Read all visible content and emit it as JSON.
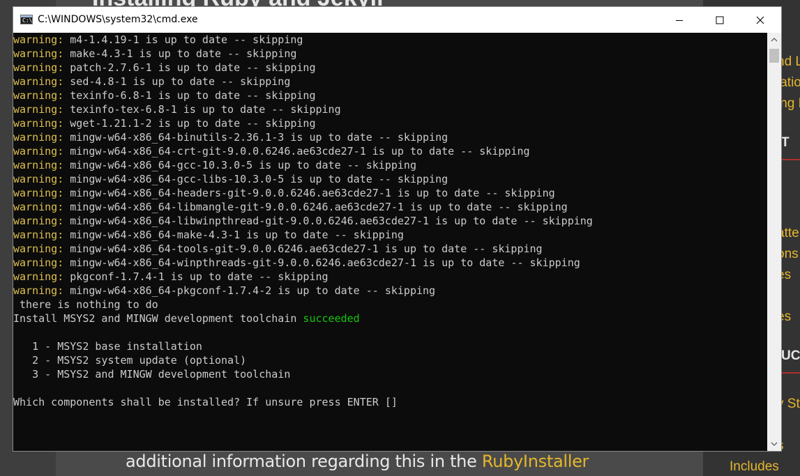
{
  "background_page": {
    "title": "Installing Ruby and Jekyll",
    "bottom_text": "additional information regarding this in the ",
    "bottom_link": "RubyInstaller",
    "sidebar": {
      "fragments": [
        "nd L",
        "latio",
        "ing F",
        "T",
        "atte",
        "ons",
        "es",
        "es",
        "UCT",
        "y St",
        "s",
        "Includes"
      ]
    }
  },
  "window": {
    "title": "C:\\WINDOWS\\system32\\cmd.exe",
    "icon": "cmd-icon",
    "controls": {
      "minimize": "minimize-icon",
      "maximize": "maximize-icon",
      "close": "close-icon"
    }
  },
  "terminal": {
    "warnings": [
      {
        "label": "warning:",
        "text": " m4-1.4.19-1 is up to date -- skipping"
      },
      {
        "label": "warning:",
        "text": " make-4.3-1 is up to date -- skipping"
      },
      {
        "label": "warning:",
        "text": " patch-2.7.6-1 is up to date -- skipping"
      },
      {
        "label": "warning:",
        "text": " sed-4.8-1 is up to date -- skipping"
      },
      {
        "label": "warning:",
        "text": " texinfo-6.8-1 is up to date -- skipping"
      },
      {
        "label": "warning:",
        "text": " texinfo-tex-6.8-1 is up to date -- skipping"
      },
      {
        "label": "warning:",
        "text": " wget-1.21.1-2 is up to date -- skipping"
      },
      {
        "label": "warning:",
        "text": " mingw-w64-x86_64-binutils-2.36.1-3 is up to date -- skipping"
      },
      {
        "label": "warning:",
        "text": " mingw-w64-x86_64-crt-git-9.0.0.6246.ae63cde27-1 is up to date -- skipping"
      },
      {
        "label": "warning:",
        "text": " mingw-w64-x86_64-gcc-10.3.0-5 is up to date -- skipping"
      },
      {
        "label": "warning:",
        "text": " mingw-w64-x86_64-gcc-libs-10.3.0-5 is up to date -- skipping"
      },
      {
        "label": "warning:",
        "text": " mingw-w64-x86_64-headers-git-9.0.0.6246.ae63cde27-1 is up to date -- skipping"
      },
      {
        "label": "warning:",
        "text": " mingw-w64-x86_64-libmangle-git-9.0.0.6246.ae63cde27-1 is up to date -- skipping"
      },
      {
        "label": "warning:",
        "text": " mingw-w64-x86_64-libwinpthread-git-9.0.0.6246.ae63cde27-1 is up to date -- skipping"
      },
      {
        "label": "warning:",
        "text": " mingw-w64-x86_64-make-4.3-1 is up to date -- skipping"
      },
      {
        "label": "warning:",
        "text": " mingw-w64-x86_64-tools-git-9.0.0.6246.ae63cde27-1 is up to date -- skipping"
      },
      {
        "label": "warning:",
        "text": " mingw-w64-x86_64-winpthreads-git-9.0.0.6246.ae63cde27-1 is up to date -- skipping"
      },
      {
        "label": "warning:",
        "text": " pkgconf-1.7.4-1 is up to date -- skipping"
      },
      {
        "label": "warning:",
        "text": " mingw-w64-x86_64-pkgconf-1.7.4-2 is up to date -- skipping"
      }
    ],
    "nothing_to_do": " there is nothing to do",
    "install_result_prefix": "Install MSYS2 and MINGW development toolchain ",
    "install_result_status": "succeeded",
    "options": [
      "   1 - MSYS2 base installation",
      "   2 - MSYS2 system update (optional)",
      "   3 - MSYS2 and MINGW development toolchain"
    ],
    "prompt": "Which components shall be installed? If unsure press ENTER []",
    "colors": {
      "warning": "#dfc04d",
      "success": "#16c60c",
      "text": "#cccccc",
      "background": "#0c0c0c"
    }
  }
}
